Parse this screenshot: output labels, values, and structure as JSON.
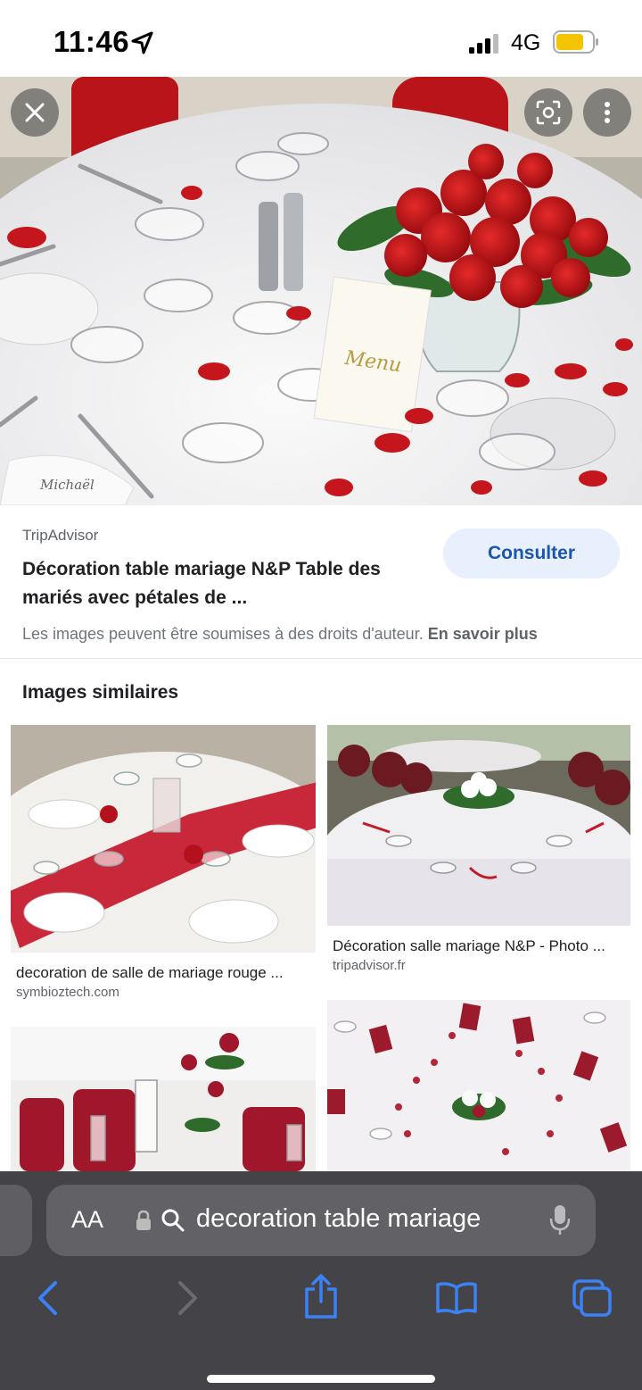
{
  "status": {
    "time": "11:46",
    "network": "4G"
  },
  "result": {
    "source": "TripAdvisor",
    "title": "Décoration table mariage N&P Table des mariés avec pétales de ...",
    "action_label": "Consulter",
    "copyright_text": "Les images peuvent être soumises à des droits d'auteur.",
    "learn_more": "En savoir plus",
    "menu_card_text": "Menu",
    "napkin_text": "Michaël"
  },
  "similar": {
    "heading": "Images similaires",
    "items": [
      {
        "caption": "decoration de salle de mariage rouge ...",
        "domain": "symbioztech.com"
      },
      {
        "caption": "Décoration salle mariage N&P - Photo ...",
        "domain": "tripadvisor.fr"
      },
      {
        "caption": "",
        "domain": ""
      },
      {
        "caption": "",
        "domain": ""
      }
    ]
  },
  "browser": {
    "text_size_label": "AA",
    "query": "decoration table mariage"
  },
  "colors": {
    "accent": "#1a56b0",
    "toolbar": "#444448",
    "rose_red": "#c4161c"
  },
  "icons": [
    "location-arrow-icon",
    "signal-icon",
    "battery-icon",
    "close-icon",
    "lens-icon",
    "more-icon",
    "lock-icon",
    "search-icon",
    "mic-icon",
    "back-icon",
    "forward-icon",
    "share-icon",
    "bookmarks-icon",
    "tabs-icon"
  ]
}
